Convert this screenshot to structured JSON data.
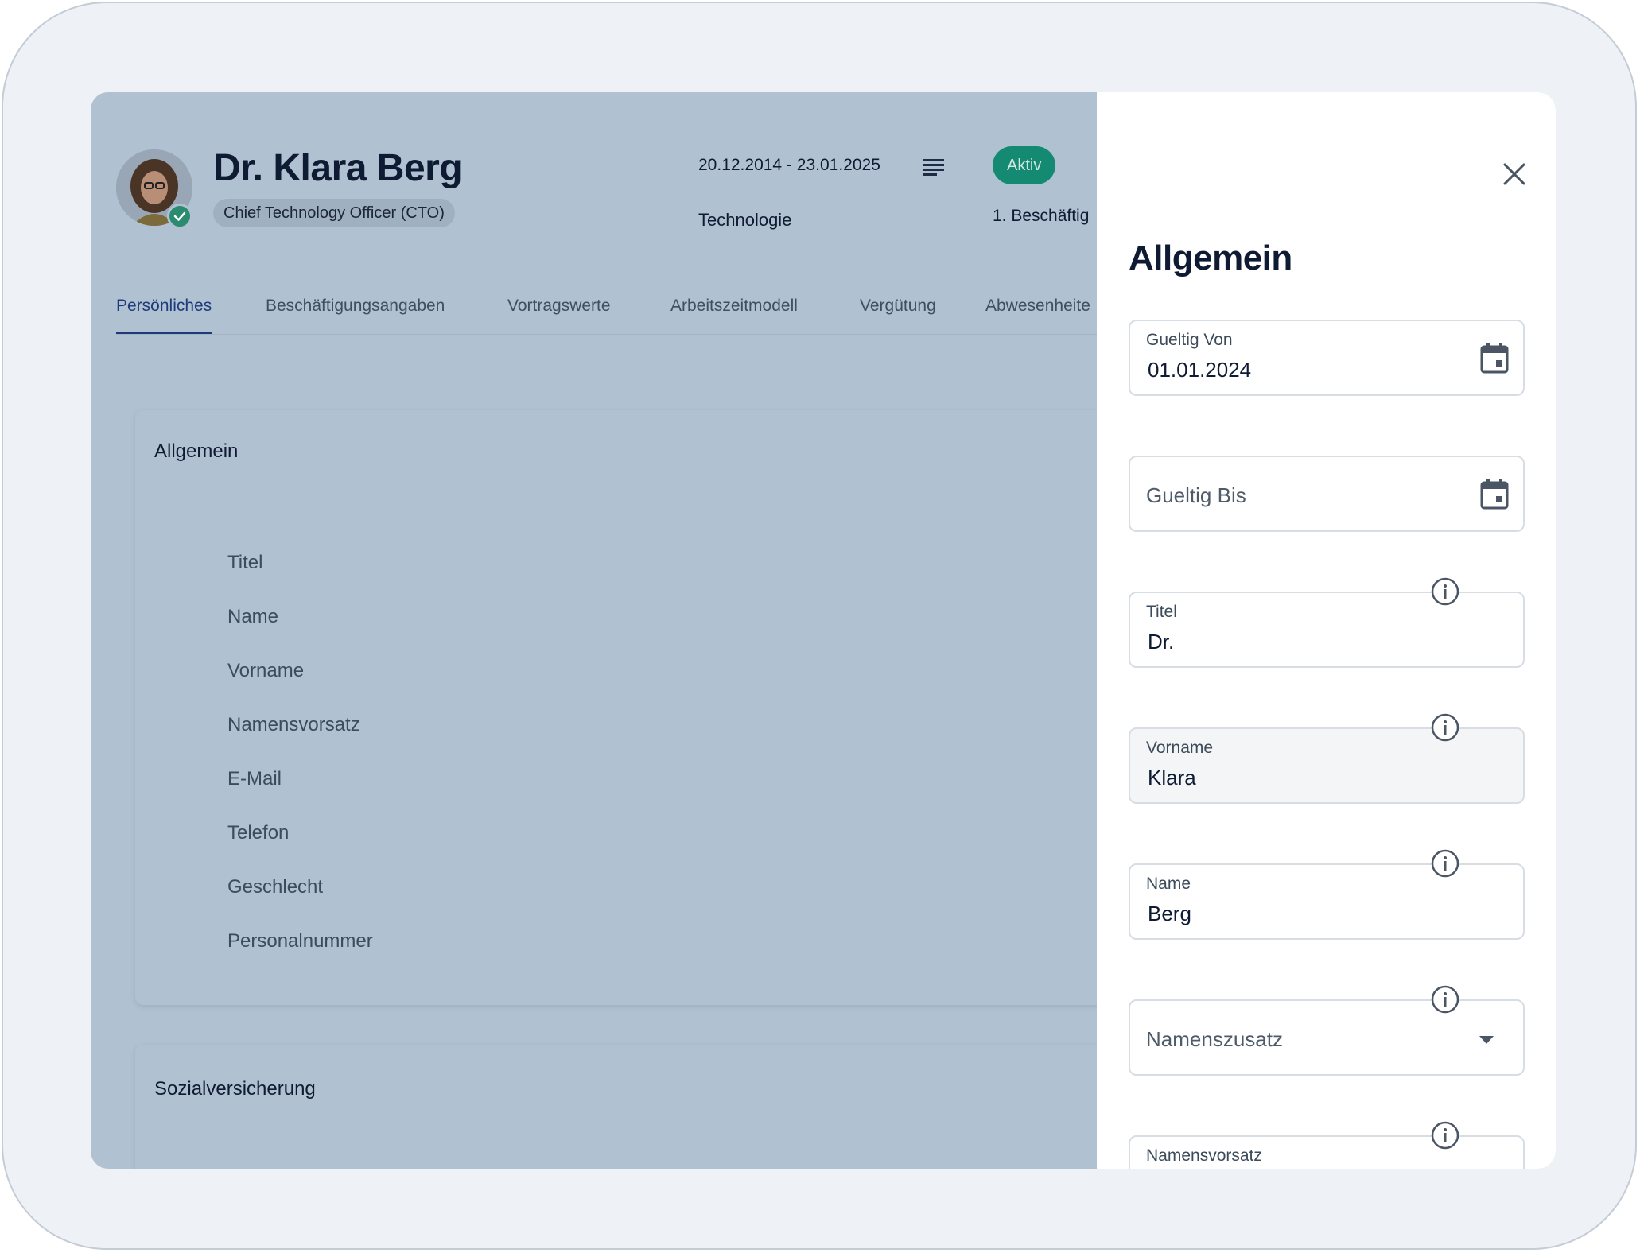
{
  "employee": {
    "name": "Dr. Klara Berg",
    "role": "Chief Technology Officer (CTO)",
    "date_range": "20.12.2014 - 23.01.2025",
    "department": "Technologie",
    "status": "Aktiv",
    "employment": "1. Beschäftig"
  },
  "tabs": [
    {
      "label": "Persönliches",
      "active": true
    },
    {
      "label": "Beschäftigungsangaben"
    },
    {
      "label": "Vortragswerte"
    },
    {
      "label": "Arbeitszeitmodell"
    },
    {
      "label": "Vergütung"
    },
    {
      "label": "Abwesenheite"
    }
  ],
  "section_general": {
    "title": "Allgemein",
    "fields": [
      "Titel",
      "Name",
      "Vorname",
      "Namensvorsatz",
      "E-Mail",
      "Telefon",
      "Geschlecht",
      "Personalnummer"
    ]
  },
  "section_social": {
    "title": "Sozialversicherung"
  },
  "drawer": {
    "title": "Allgemein",
    "valid_from": {
      "label": "Gueltig Von",
      "value": "01.01.2024"
    },
    "valid_to": {
      "placeholder": "Gueltig Bis"
    },
    "title_field": {
      "label": "Titel",
      "value": "Dr."
    },
    "first_name": {
      "label": "Vorname",
      "value": "Klara"
    },
    "last_name": {
      "label": "Name",
      "value": "Berg"
    },
    "name_suffix": {
      "placeholder": "Namenszusatz"
    },
    "name_prefix": {
      "label": "Namensvorsatz"
    }
  },
  "colors": {
    "accent": "#1e3a7a",
    "status_green": "#148a72",
    "overlay": "#b0c1d1"
  },
  "icons": [
    "list-icon",
    "check-icon",
    "close-icon",
    "calendar-icon",
    "info-icon",
    "dropdown-arrow-icon"
  ]
}
